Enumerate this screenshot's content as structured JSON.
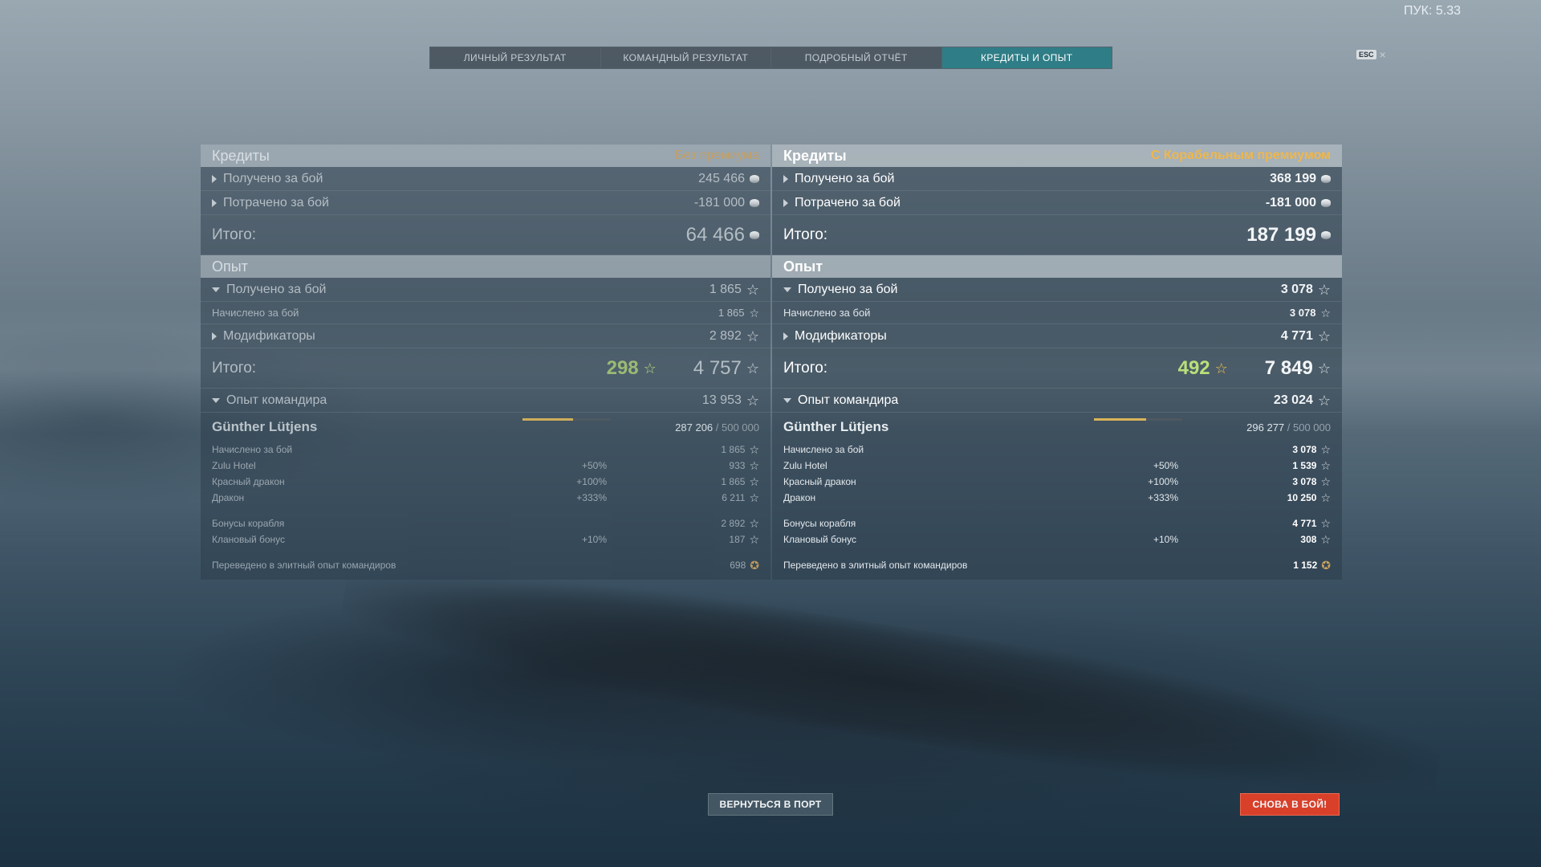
{
  "fps_label": "ПУК: 5.33",
  "tabs": [
    {
      "label": "ЛИЧНЫЙ РЕЗУЛЬТАТ",
      "active": false
    },
    {
      "label": "КОМАНДНЫЙ РЕЗУЛЬТАТ",
      "active": false
    },
    {
      "label": "ПОДРОБНЫЙ ОТЧЁТ",
      "active": false
    },
    {
      "label": "КРЕДИТЫ И ОПЫТ",
      "active": true
    }
  ],
  "esc": {
    "key": "ESC",
    "close": "×"
  },
  "left": {
    "credits_title": "Кредиты",
    "premium_label": "Без премиума",
    "earned_label": "Получено за бой",
    "earned_value": "245 466",
    "spent_label": "Потрачено за бой",
    "spent_value": "-181 000",
    "credits_total_label": "Итого:",
    "credits_total": "64 466",
    "xp_title": "Опыт",
    "xp_earned_label": "Получено за бой",
    "xp_earned": "1 865",
    "xp_awarded_label": "Начислено за бой",
    "xp_awarded": "1 865",
    "modifiers_label": "Модификаторы",
    "modifiers": "2 892",
    "xp_total_label": "Итого:",
    "free_xp": "298",
    "xp_total": "4 757",
    "cmdr_xp_label": "Опыт командира",
    "cmdr_xp": "13 953",
    "cmdr_name": "Günther Lütjens",
    "cmdr_progress": "287 206",
    "cmdr_max": "/ 500 000",
    "cmdr_progress_fraction": 0.574,
    "details": [
      {
        "label": "Начислено за бой",
        "mod": "",
        "value": "1 865"
      },
      {
        "label": "Zulu Hotel",
        "mod": "+50%",
        "value": "933"
      },
      {
        "label": "Красный дракон",
        "mod": "+100%",
        "value": "1 865"
      },
      {
        "label": "Дракон",
        "mod": "+333%",
        "value": "6 211"
      }
    ],
    "bonuses": [
      {
        "label": "Бонусы корабля",
        "mod": "",
        "value": "2 892"
      },
      {
        "label": "Клановый бонус",
        "mod": "+10%",
        "value": "187"
      }
    ],
    "elite_label": "Переведено в элитный опыт командиров",
    "elite_value": "698"
  },
  "right": {
    "credits_title": "Кредиты",
    "premium_label": "С Корабельным премиумом",
    "earned_label": "Получено за бой",
    "earned_value": "368 199",
    "spent_label": "Потрачено за бой",
    "spent_value": "-181 000",
    "credits_total_label": "Итого:",
    "credits_total": "187 199",
    "xp_title": "Опыт",
    "xp_earned_label": "Получено за бой",
    "xp_earned": "3 078",
    "xp_awarded_label": "Начислено за бой",
    "xp_awarded": "3 078",
    "modifiers_label": "Модификаторы",
    "modifiers": "4 771",
    "xp_total_label": "Итого:",
    "free_xp": "492",
    "xp_total": "7 849",
    "cmdr_xp_label": "Опыт командира",
    "cmdr_xp": "23 024",
    "cmdr_name": "Günther Lütjens",
    "cmdr_progress": "296 277",
    "cmdr_max": "/ 500 000",
    "cmdr_progress_fraction": 0.593,
    "details": [
      {
        "label": "Начислено за бой",
        "mod": "",
        "value": "3 078"
      },
      {
        "label": "Zulu Hotel",
        "mod": "+50%",
        "value": "1 539"
      },
      {
        "label": "Красный дракон",
        "mod": "+100%",
        "value": "3 078"
      },
      {
        "label": "Дракон",
        "mod": "+333%",
        "value": "10 250"
      }
    ],
    "bonuses": [
      {
        "label": "Бонусы корабля",
        "mod": "",
        "value": "4 771"
      },
      {
        "label": "Клановый бонус",
        "mod": "+10%",
        "value": "308"
      }
    ],
    "elite_label": "Переведено в элитный опыт командиров",
    "elite_value": "1 152"
  },
  "buttons": {
    "port": "ВЕРНУТЬСЯ В ПОРТ",
    "battle": "СНОВА В БОЙ!"
  },
  "colors": {
    "accent_tab": "#2f7d86",
    "premium": "#f0b64a",
    "free_xp": "#b8e07a",
    "battle_button": "#d8402a"
  }
}
